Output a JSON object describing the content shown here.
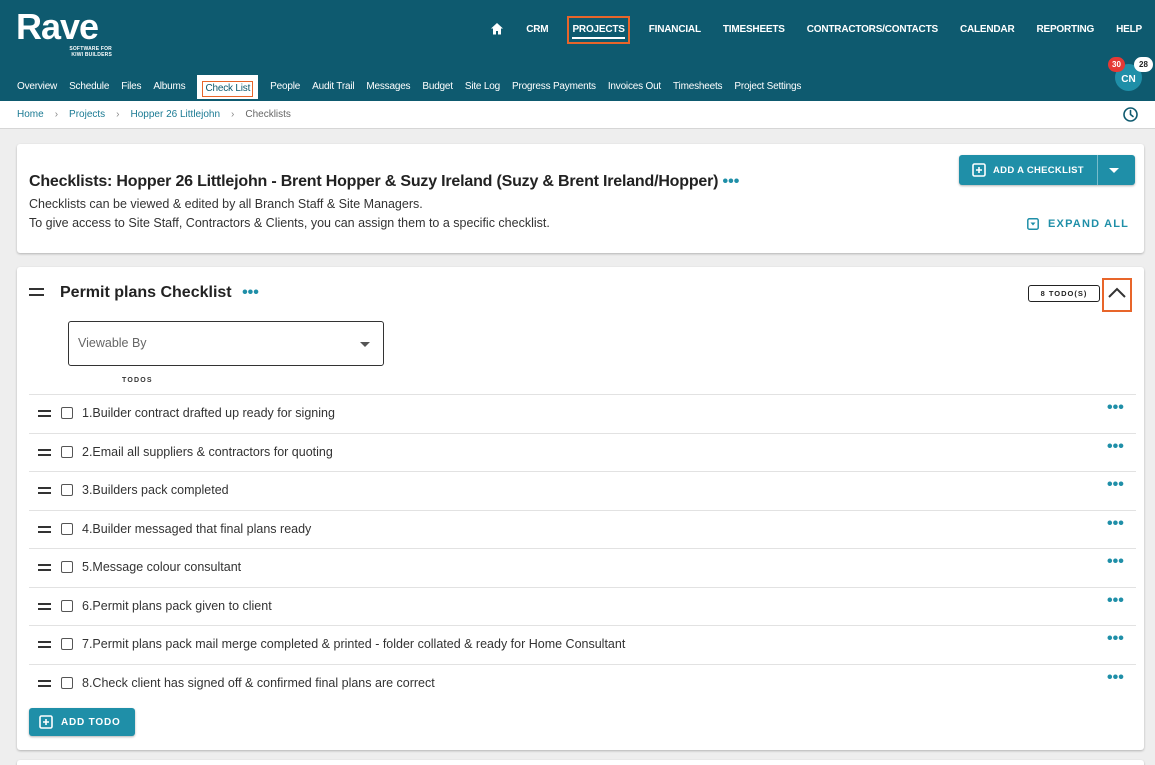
{
  "brand": {
    "name": "Rave",
    "tagline_line1": "SOFTWARE FOR",
    "tagline_line2": "KIWI BUILDERS"
  },
  "top_nav": {
    "home_icon": "home-icon",
    "items": [
      "CRM",
      "PROJECTS",
      "FINANCIAL",
      "TIMESHEETS",
      "CONTRACTORS/CONTACTS",
      "CALENDAR",
      "REPORTING",
      "HELP"
    ],
    "active": "PROJECTS"
  },
  "sub_nav": {
    "items": [
      "Overview",
      "Schedule",
      "Files",
      "Albums",
      "Check List",
      "People",
      "Audit Trail",
      "Messages",
      "Budget",
      "Site Log",
      "Progress Payments",
      "Invoices Out",
      "Timesheets",
      "Project Settings"
    ],
    "active": "Check List"
  },
  "user": {
    "initials": "CN",
    "badge_red": "30",
    "badge_white": "28"
  },
  "breadcrumb": [
    "Home",
    "Projects",
    "Hopper 26 Littlejohn",
    "Checklists"
  ],
  "header_card": {
    "title": "Checklists: Hopper 26 Littlejohn - Brent Hopper & Suzy Ireland (Suzy & Brent Ireland/Hopper)",
    "more": "•••",
    "desc_line1": "Checklists can be viewed & edited by all Branch Staff & Site Managers.",
    "desc_line2": "To give access to Site Staff, Contractors & Clients, you can assign them to a specific checklist.",
    "add_button": "ADD A CHECKLIST",
    "expand_all": "EXPAND ALL"
  },
  "checklist": {
    "title": "Permit plans Checklist",
    "more": "•••",
    "todo_count": "8 TODO(S)",
    "viewable_by_placeholder": "Viewable By",
    "todos_header": "TODOS",
    "todos": [
      "1.Builder contract drafted up ready for signing",
      "2.Email all suppliers & contractors for quoting",
      "3.Builders pack completed",
      "4.Builder messaged that final plans ready",
      "5.Message colour consultant",
      "6.Permit plans pack given to client",
      "7.Permit plans pack mail merge completed & printed - folder collated & ready for Home Consultant",
      "8.Check client has signed off & confirmed final plans are correct"
    ],
    "row_more": "•••",
    "add_todo": "ADD TODO"
  },
  "colors": {
    "header_bg": "#0e5a6f",
    "accent": "#1f8fa8",
    "highlight": "#e8652a"
  }
}
